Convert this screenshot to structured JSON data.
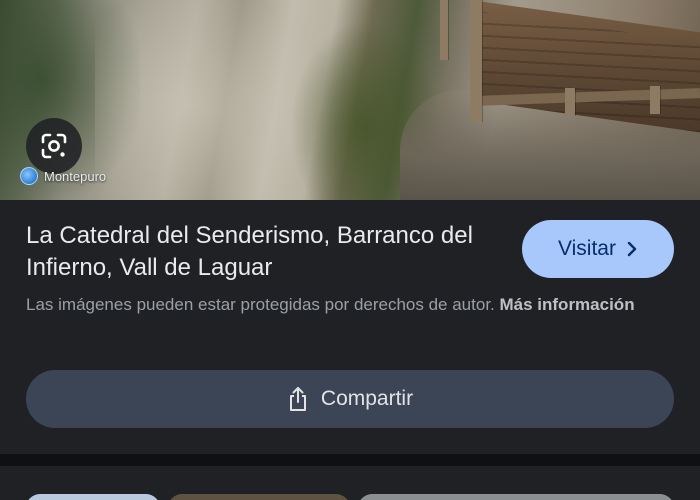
{
  "photo": {
    "source_name": "Montepuro",
    "lens_button_icon": "google-lens-icon",
    "source_icon": "site-favicon-icon"
  },
  "result": {
    "title": "La Catedral del Senderismo, Barranco del Infierno, Vall de Laguar",
    "visit_label": "Visitar",
    "visit_icon": "chevron-right-icon",
    "copyright_text": "Las imágenes pueden estar protegidas por derechos de autor.",
    "more_info_label": "Más información",
    "share_label": "Compartir",
    "share_icon": "share-icon"
  },
  "colors": {
    "background": "#1f2125",
    "visit_button": "#a8c7fa",
    "share_button": "#3b4556"
  }
}
